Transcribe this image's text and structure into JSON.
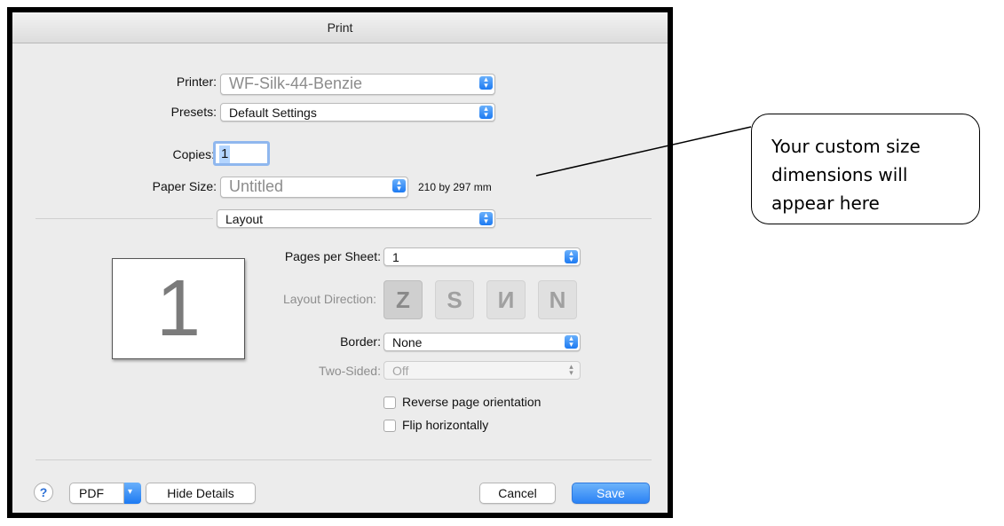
{
  "window": {
    "title": "Print"
  },
  "printer": {
    "label": "Printer:",
    "value": "WF-Silk-44-Benzie"
  },
  "presets": {
    "label": "Presets:",
    "value": "Default Settings"
  },
  "copies": {
    "label": "Copies:",
    "value": "1"
  },
  "paper_size": {
    "label": "Paper Size:",
    "value": "Untitled",
    "dimensions": "210 by 297 mm"
  },
  "section": {
    "value": "Layout"
  },
  "layout": {
    "pages_per_sheet_label": "Pages per Sheet:",
    "pages_per_sheet_value": "1",
    "direction_label": "Layout Direction:",
    "directions": [
      "Z",
      "S",
      "N",
      "N"
    ],
    "direction_icons": [
      "layout-z-icon",
      "layout-s-icon",
      "layout-n-mirrored-icon",
      "layout-n-icon"
    ],
    "border_label": "Border:",
    "border_value": "None",
    "two_sided_label": "Two-Sided:",
    "two_sided_value": "Off",
    "reverse_label": "Reverse page orientation",
    "flip_label": "Flip horizontally",
    "preview_page": "1"
  },
  "footer": {
    "help_symbol": "?",
    "pdf_label": "PDF",
    "hide_details_label": "Hide Details",
    "cancel_label": "Cancel",
    "save_label": "Save"
  },
  "annotation": {
    "text": "Your custom size dimensions will appear here"
  },
  "colors": {
    "accent": "#2a82f5",
    "window_bg": "#ececec"
  }
}
